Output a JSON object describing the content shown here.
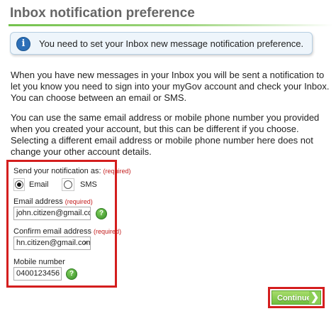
{
  "page": {
    "title": "Inbox notification preference"
  },
  "info": {
    "icon": "info-icon",
    "icon_glyph": "i",
    "text": "You need to set your Inbox new message notification preference."
  },
  "paragraphs": [
    "When you have new messages in your Inbox you will be sent a notification to let you know you need to sign into your myGov account and check your Inbox. You can choose between an email or SMS.",
    "You can use the same email address or mobile phone number you provided when you created your account, but this can be different if you choose. Selecting a different email address or mobile phone number here does not change your other account details."
  ],
  "form": {
    "send_label": "Send your notification as:",
    "required_tag": "(required)",
    "options": [
      {
        "label": "Email",
        "selected": true
      },
      {
        "label": "SMS",
        "selected": false
      }
    ],
    "email_label": "Email address",
    "email_value": "john.citizen@gmail.com",
    "confirm_label": "Confirm email address",
    "confirm_value": "hn.citizen@gmail.com",
    "clear_glyph": "×",
    "mobile_label": "Mobile number",
    "mobile_value": "0400123456",
    "help_glyph": "?"
  },
  "actions": {
    "continue_label": "Continue",
    "continue_glyph": "❯"
  },
  "colors": {
    "highlight_border": "#d41e1e",
    "accent_green": "#6fbf3c",
    "info_blue": "#2c6fb8"
  }
}
